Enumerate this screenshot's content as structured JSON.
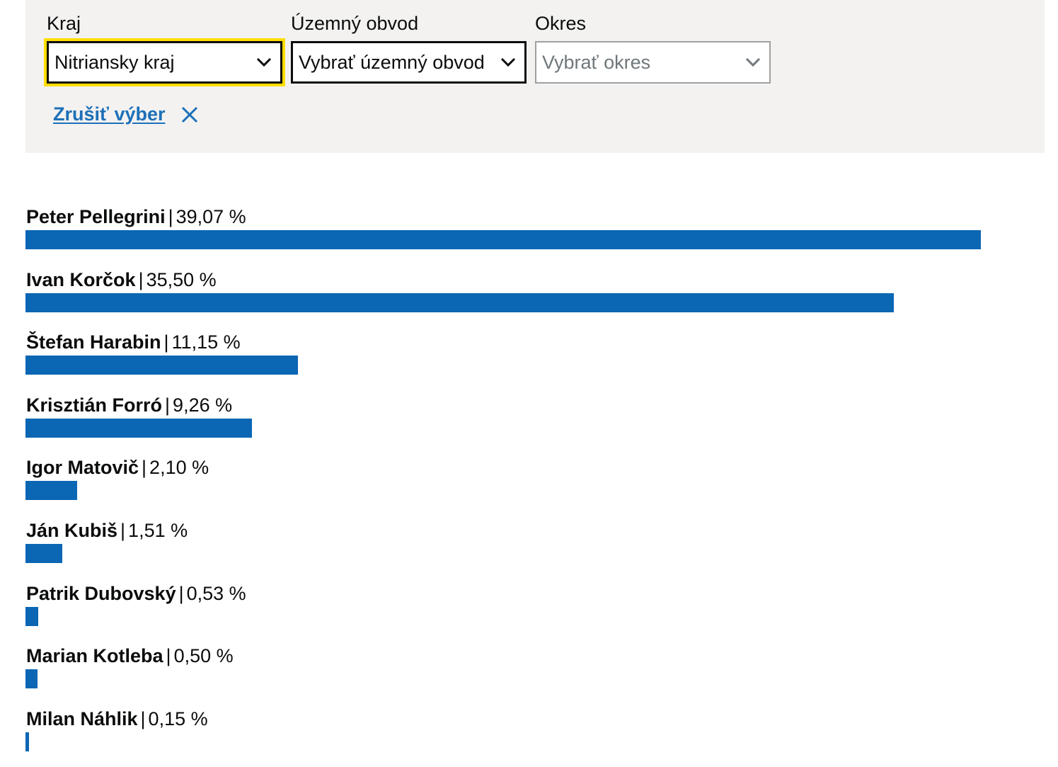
{
  "filters": {
    "kraj": {
      "label": "Kraj",
      "value": "Nitriansky kraj"
    },
    "uzemny_obvod": {
      "label": "Územný obvod",
      "value": "Vybrať územný obvod"
    },
    "okres": {
      "label": "Okres",
      "value": "Vybrať okres"
    },
    "clear_label": "Zrušiť výber"
  },
  "colors": {
    "bar": "#0b66b4",
    "link": "#1d70b8",
    "focus": "#ffdd00",
    "panel": "#f3f2f1"
  },
  "results": [
    {
      "name": "Peter Pellegrini",
      "percent_text": "39,07 %",
      "percent": 39.07
    },
    {
      "name": "Ivan Korčok",
      "percent_text": "35,50 %",
      "percent": 35.5
    },
    {
      "name": "Štefan Harabin",
      "percent_text": "11,15 %",
      "percent": 11.15
    },
    {
      "name": "Krisztián Forró",
      "percent_text": "9,26 %",
      "percent": 9.26
    },
    {
      "name": "Igor Matovič",
      "percent_text": "2,10 %",
      "percent": 2.1
    },
    {
      "name": "Ján Kubiš",
      "percent_text": "1,51 %",
      "percent": 1.51
    },
    {
      "name": "Patrik Dubovský",
      "percent_text": "0,53 %",
      "percent": 0.53
    },
    {
      "name": "Marian Kotleba",
      "percent_text": "0,50 %",
      "percent": 0.5
    },
    {
      "name": "Milan Náhlik",
      "percent_text": "0,15 %",
      "percent": 0.15
    }
  ]
}
